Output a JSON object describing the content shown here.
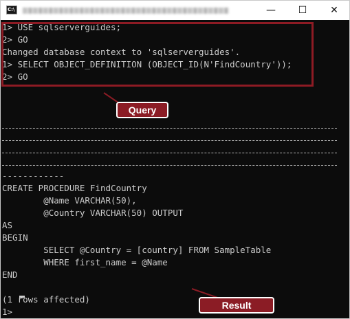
{
  "window": {
    "title": "C:\\...\\sqlcmd.exe",
    "app_icon_text": "C:\\",
    "minimize_glyph": "—",
    "maximize_glyph": "☐",
    "close_glyph": "✕"
  },
  "terminal": {
    "lines": [
      "1> USE sqlserverguides;",
      "2> GO",
      "Changed database context to 'sqlserverguides'.",
      "1> SELECT OBJECT_DEFINITION (OBJECT_ID(N'FindCountry'));",
      "2> GO"
    ],
    "separator_short": "------------",
    "output": [
      "CREATE PROCEDURE FindCountry",
      "        @Name VARCHAR(50),",
      "        @Country VARCHAR(50) OUTPUT",
      "AS",
      "BEGIN",
      "        SELECT @Country = [country] FROM SampleTable",
      "        WHERE first_name = @Name",
      "END",
      "",
      "(1 rows affected)",
      "1> "
    ]
  },
  "annotations": {
    "query_label": "Query",
    "result_label": "Result",
    "accent_color": "#8b1c25"
  }
}
